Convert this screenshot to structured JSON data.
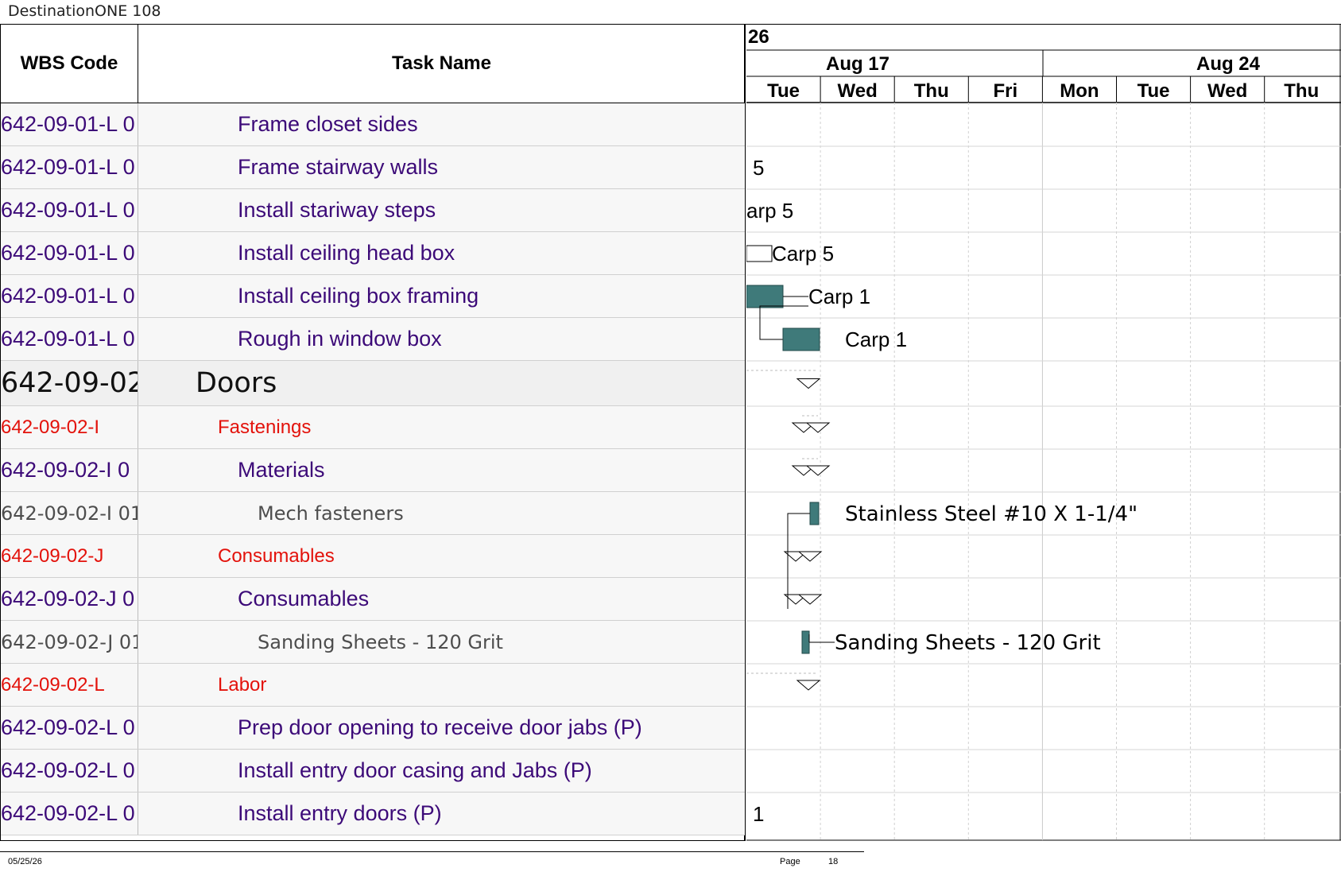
{
  "doc_title": "DestinationONE 108",
  "table": {
    "headers": {
      "wbs": "WBS Code",
      "name": "Task Name"
    },
    "rows": [
      {
        "wbs": "642-09-01-L 0",
        "name": "Frame closet sides",
        "style": "purple",
        "indent": 2
      },
      {
        "wbs": "642-09-01-L 0",
        "name": "Frame stairway walls",
        "style": "purple",
        "indent": 2
      },
      {
        "wbs": "642-09-01-L 0",
        "name": "Install stariway steps",
        "style": "purple",
        "indent": 2
      },
      {
        "wbs": "642-09-01-L 0",
        "name": "Install ceiling head box",
        "style": "purple",
        "indent": 2
      },
      {
        "wbs": "642-09-01-L 0",
        "name": "Install ceiling box framing",
        "style": "purple",
        "indent": 2
      },
      {
        "wbs": "642-09-01-L 0",
        "name": "Rough in window box",
        "style": "purple",
        "indent": 2
      },
      {
        "wbs": "642-09-02",
        "name": "Doors",
        "style": "black-big",
        "indent": 0
      },
      {
        "wbs": "642-09-02-I",
        "name": "Fastenings",
        "style": "red",
        "indent": 1
      },
      {
        "wbs": "642-09-02-I 0",
        "name": "Materials",
        "style": "purple",
        "indent": 2
      },
      {
        "wbs": "642-09-02-I 01",
        "name": "Mech fasteners",
        "style": "grey",
        "indent": 3
      },
      {
        "wbs": "642-09-02-J",
        "name": "Consumables",
        "style": "red",
        "indent": 1
      },
      {
        "wbs": "642-09-02-J 0",
        "name": "Consumables",
        "style": "purple",
        "indent": 2
      },
      {
        "wbs": "642-09-02-J 01",
        "name": "Sanding Sheets - 120 Grit",
        "style": "grey",
        "indent": 3
      },
      {
        "wbs": "642-09-02-L",
        "name": "Labor",
        "style": "red",
        "indent": 1
      },
      {
        "wbs": "642-09-02-L 0",
        "name": "Prep door opening to receive door jabs (P)",
        "style": "purple",
        "indent": 2
      },
      {
        "wbs": "642-09-02-L 0",
        "name": "Install entry door casing and Jabs (P)",
        "style": "purple",
        "indent": 2
      },
      {
        "wbs": "642-09-02-L 0",
        "name": "Install entry doors (P)",
        "style": "purple",
        "indent": 2
      }
    ]
  },
  "gantt": {
    "year_label": "26",
    "weeks": [
      "Aug 17",
      "Aug 24"
    ],
    "days": [
      "Tue",
      "Wed",
      "Thu",
      "Fri",
      "Mon",
      "Tue",
      "Wed",
      "Thu"
    ],
    "labels": [
      "5",
      "arp 5",
      "Carp 5",
      "Carp 1",
      "Carp 1",
      "Stainless Steel #10 X 1-1/4\"",
      "Sanding Sheets - 120 Grit",
      "1"
    ],
    "bar_color": "#3f7a7a"
  },
  "footer": {
    "date": "05/25/26",
    "page_label": "Page",
    "page_number": "18"
  }
}
